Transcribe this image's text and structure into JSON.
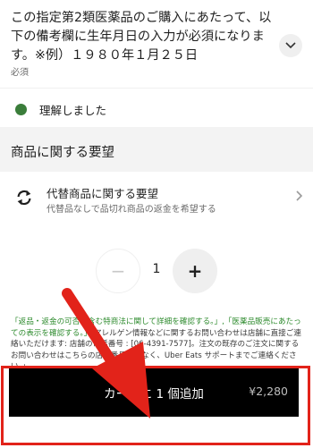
{
  "notice": {
    "text": "この指定第2類医薬品のご購入にあたって、以下の備考欄に生年月日の入力が必須になります。※例）１９８０年１月２５日",
    "required": "必須"
  },
  "confirm": {
    "label": "理解しました"
  },
  "section": {
    "title": "商品に関する要望"
  },
  "request": {
    "title": "代替商品に関する要望",
    "subtitle": "代替品なしで品切れ商品の返金を希望する"
  },
  "stepper": {
    "minus": "−",
    "quantity": "1",
    "plus": "+"
  },
  "disclaimer": {
    "part1": "「返品・返金の可否を含む特商法に関して詳細を確認する。」,「医薬品販売にあたっての表示を確認する。」",
    "part2": ",アレルゲン情報などに関するお問い合わせは店舗に直接ご連絡いただけます: 店舗の電話番号 : [06-4391-7577]。注文の既存のご注文に関するお問い合わせはこちらの店舗番号ではなく、Uber Eats サポートまでご連絡ください。」"
  },
  "cart": {
    "label": "カートに 1 個追加",
    "price": "¥2,280"
  },
  "colors": {
    "accent_green": "#3a7d3a",
    "annotation_red": "#e2231a",
    "button_black": "#000000"
  }
}
